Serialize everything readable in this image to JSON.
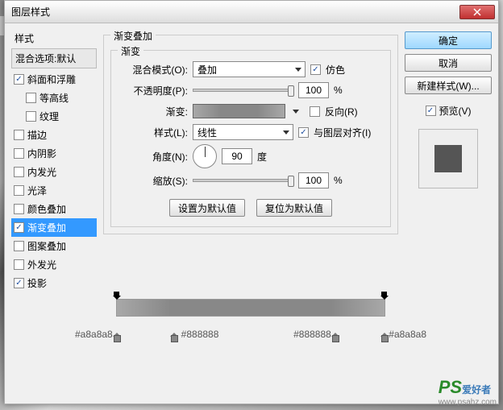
{
  "dialog": {
    "title": "图层样式"
  },
  "left": {
    "styles_label": "样式",
    "blend_default": "混合选项:默认",
    "items": [
      {
        "label": "斜面和浮雕",
        "checked": true,
        "indent": false
      },
      {
        "label": "等高线",
        "checked": false,
        "indent": true
      },
      {
        "label": "纹理",
        "checked": false,
        "indent": true
      },
      {
        "label": "描边",
        "checked": false,
        "indent": false
      },
      {
        "label": "内阴影",
        "checked": false,
        "indent": false
      },
      {
        "label": "内发光",
        "checked": false,
        "indent": false
      },
      {
        "label": "光泽",
        "checked": false,
        "indent": false
      },
      {
        "label": "颜色叠加",
        "checked": false,
        "indent": false
      },
      {
        "label": "渐变叠加",
        "checked": true,
        "indent": false,
        "selected": true
      },
      {
        "label": "图案叠加",
        "checked": false,
        "indent": false
      },
      {
        "label": "外发光",
        "checked": false,
        "indent": false
      },
      {
        "label": "投影",
        "checked": true,
        "indent": false
      }
    ]
  },
  "main": {
    "group_title": "渐变叠加",
    "inner_title": "渐变",
    "blend_mode_label": "混合模式(O):",
    "blend_mode_value": "叠加",
    "dither_label": "仿色",
    "dither_checked": true,
    "opacity_label": "不透明度(P):",
    "opacity_value": "100",
    "opacity_unit": "%",
    "gradient_label": "渐变:",
    "reverse_label": "反向(R)",
    "reverse_checked": false,
    "style_label": "样式(L):",
    "style_value": "线性",
    "align_label": "与图层对齐(I)",
    "align_checked": true,
    "angle_label": "角度(N):",
    "angle_value": "90",
    "angle_unit": "度",
    "scale_label": "缩放(S):",
    "scale_value": "100",
    "scale_unit": "%",
    "btn_default": "设置为默认值",
    "btn_reset": "复位为默认值"
  },
  "right": {
    "ok": "确定",
    "cancel": "取消",
    "new_style": "新建样式(W)...",
    "preview_label": "预览(V)",
    "preview_checked": true
  },
  "grad": {
    "hex1": "#a8a8a8",
    "hex2": "#888888",
    "hex3": "#888888",
    "hex4": "#a8a8a8"
  },
  "watermark": {
    "ps": "PS",
    "txt": "爱好者",
    "url": "www.psahz.com"
  }
}
